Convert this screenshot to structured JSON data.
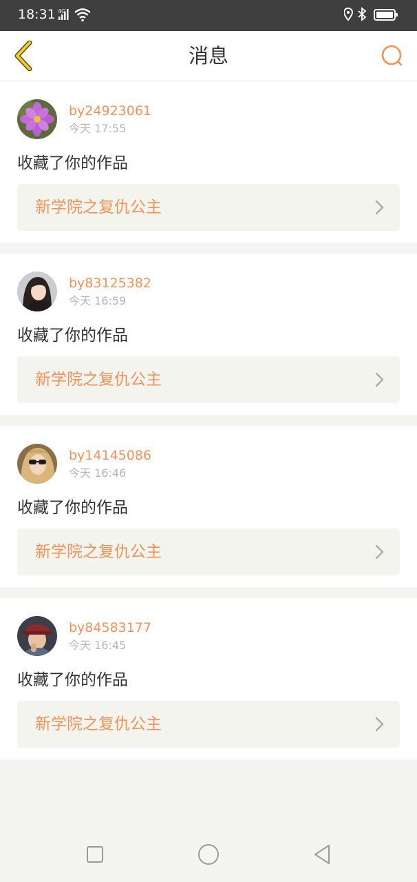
{
  "status_bar": {
    "time": "18:31",
    "network": "4G"
  },
  "header": {
    "title": "消息",
    "accent_color": "#f0925a",
    "back_icon_color": "#e6b800"
  },
  "messages": [
    {
      "username": "by24923061",
      "time": "今天 17:55",
      "action": "收藏了你的作品",
      "work_title": "新学院之复仇公主",
      "avatar_icon": "flower-avatar"
    },
    {
      "username": "by83125382",
      "time": "今天 16:59",
      "action": "收藏了你的作品",
      "work_title": "新学院之复仇公主",
      "avatar_icon": "girl-avatar"
    },
    {
      "username": "by14145086",
      "time": "今天 16:46",
      "action": "收藏了你的作品",
      "work_title": "新学院之复仇公主",
      "avatar_icon": "sunglasses-avatar"
    },
    {
      "username": "by84583177",
      "time": "今天 16:45",
      "action": "收藏了你的作品",
      "work_title": "新学院之复仇公主",
      "avatar_icon": "hat-avatar"
    }
  ]
}
